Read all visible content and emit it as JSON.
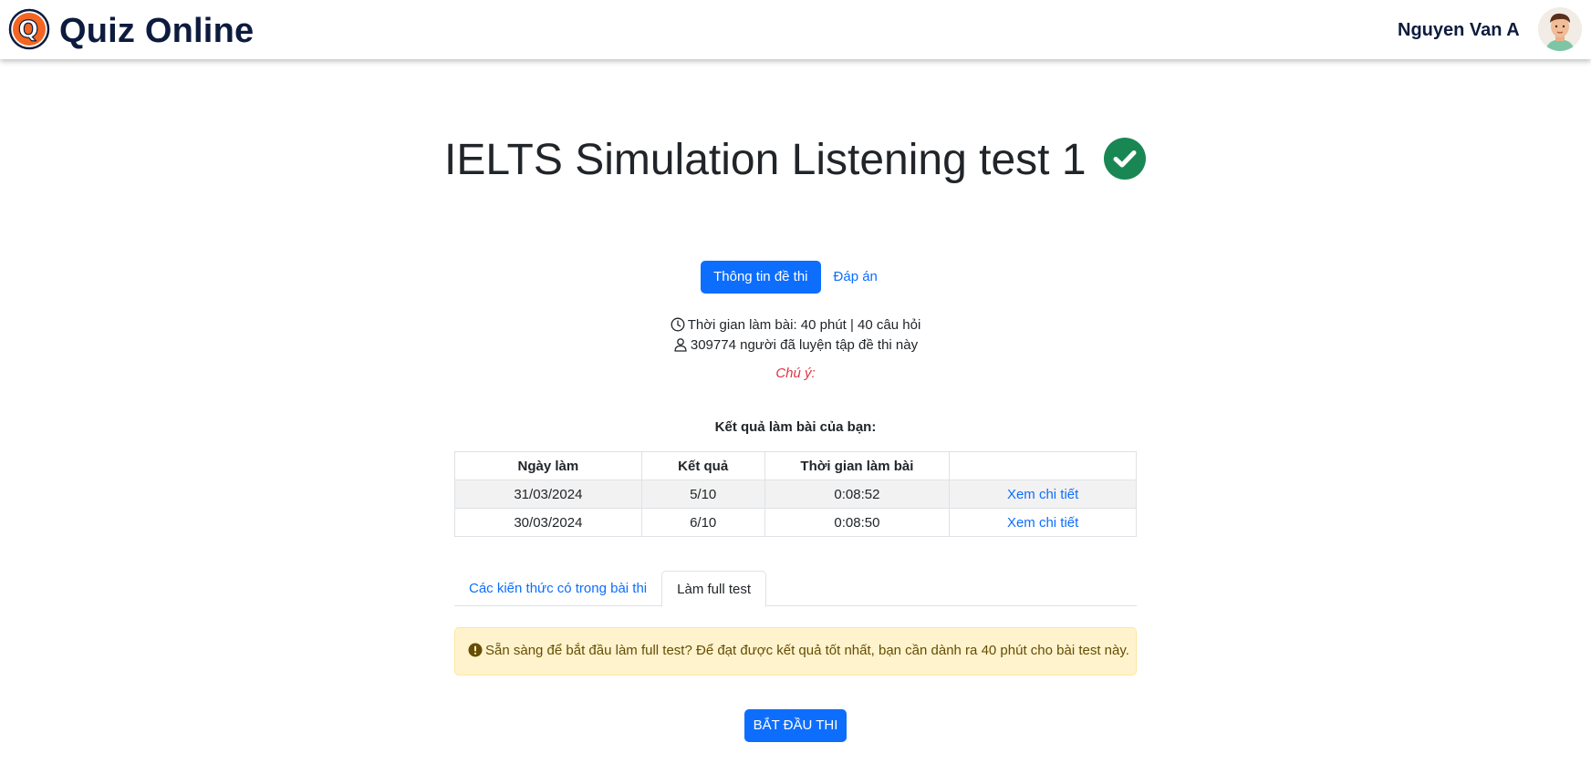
{
  "header": {
    "brand": "Quiz Online",
    "logo_letter": "Q",
    "user_name": "Nguyen Van A"
  },
  "main": {
    "title": "IELTS Simulation Listening test 1",
    "pills": [
      {
        "label": "Thông tin đề thi",
        "active": true
      },
      {
        "label": "Đáp án",
        "active": false
      }
    ],
    "info": {
      "duration": "Thời gian làm bài: 40 phút | 40 câu hỏi",
      "practitioners": "309774 người đã luyện tập đề thi này",
      "note": "Chú ý:"
    },
    "results": {
      "heading": "Kết quả làm bài của bạn:",
      "columns": [
        "Ngày làm",
        "Kết quả",
        "Thời gian làm bài",
        ""
      ],
      "rows": [
        {
          "date": "31/03/2024",
          "score": "5/10",
          "time": "0:08:52",
          "action": "Xem chi tiết"
        },
        {
          "date": "30/03/2024",
          "score": "6/10",
          "time": "0:08:50",
          "action": "Xem chi tiết"
        }
      ]
    },
    "tabs": [
      {
        "label": "Các kiến thức có trong bài thi",
        "active": false
      },
      {
        "label": "Làm full test",
        "active": true
      }
    ],
    "alert": "Sẵn sàng để bắt đầu làm full test? Để đạt được kết quả tốt nhất, bạn cần dành ra 40 phút cho bài test này.",
    "start_button": "BẮT ĐẦU THI"
  },
  "icons": {
    "logo": "quiz-logo-icon",
    "title_status": "check-circle-icon",
    "duration": "clock-icon",
    "practitioners": "user-icon",
    "alert": "exclamation-circle-icon"
  },
  "colors": {
    "primary": "#0d6efd",
    "brand_text": "#0d1b3e",
    "success": "#198754",
    "danger": "#dc3545",
    "logo_orange": "#f26522",
    "alert_bg": "#fff3cd",
    "alert_text": "#664d03"
  }
}
